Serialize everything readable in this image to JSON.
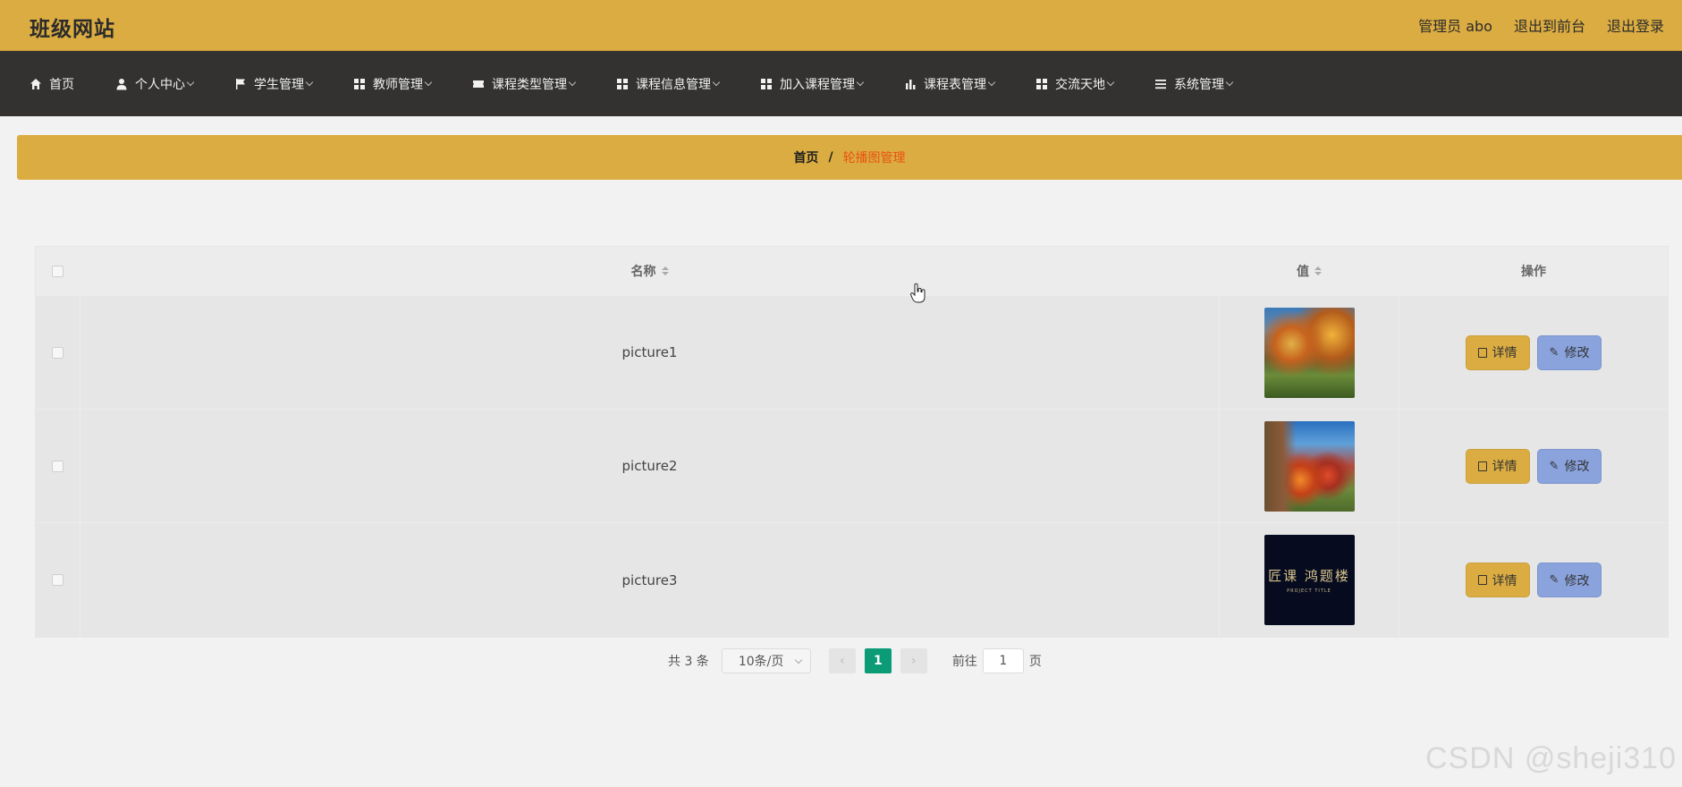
{
  "header": {
    "site_title": "班级网站",
    "admin_label": "管理员 abo",
    "front_link": "退出到前台",
    "logout_link": "退出登录"
  },
  "nav": {
    "items": [
      {
        "label": "首页",
        "icon": "home-icon",
        "has_dropdown": false
      },
      {
        "label": "个人中心",
        "icon": "user-icon",
        "has_dropdown": true
      },
      {
        "label": "学生管理",
        "icon": "flag-icon",
        "has_dropdown": true
      },
      {
        "label": "教师管理",
        "icon": "grid-icon",
        "has_dropdown": true
      },
      {
        "label": "课程类型管理",
        "icon": "ticket-icon",
        "has_dropdown": true
      },
      {
        "label": "课程信息管理",
        "icon": "grid-icon",
        "has_dropdown": true
      },
      {
        "label": "加入课程管理",
        "icon": "grid-icon",
        "has_dropdown": true
      },
      {
        "label": "课程表管理",
        "icon": "bar-chart-icon",
        "has_dropdown": true
      },
      {
        "label": "交流天地",
        "icon": "grid-icon",
        "has_dropdown": true
      },
      {
        "label": "系统管理",
        "icon": "list-icon",
        "has_dropdown": true
      }
    ]
  },
  "breadcrumb": {
    "home": "首页",
    "separator": "/",
    "current": "轮播图管理"
  },
  "table": {
    "columns": {
      "name": "名称",
      "value": "值",
      "actions": "操作"
    },
    "rows": [
      {
        "name": "picture1",
        "image": "autumn-campus-thumbnail"
      },
      {
        "name": "picture2",
        "image": "campus-garden-thumbnail"
      },
      {
        "name": "picture3",
        "image": "dark-logo-thumbnail",
        "image_text": "匠课 鸿题楼",
        "image_subtext": "PROJECT TITLE"
      }
    ],
    "detail_label": "详情",
    "edit_label": "修改"
  },
  "pagination": {
    "total": "共 3 条",
    "page_size": "10条/页",
    "current_page": "1",
    "goto_label": "前往",
    "goto_value": "1",
    "page_suffix": "页"
  },
  "watermark": "CSDN @sheji310",
  "colors": {
    "header_bg": "#dbac41",
    "nav_bg": "#333230",
    "active_crumb": "#e8530e",
    "edit_button": "#8aa3dd",
    "page_active": "#0c9b77"
  }
}
